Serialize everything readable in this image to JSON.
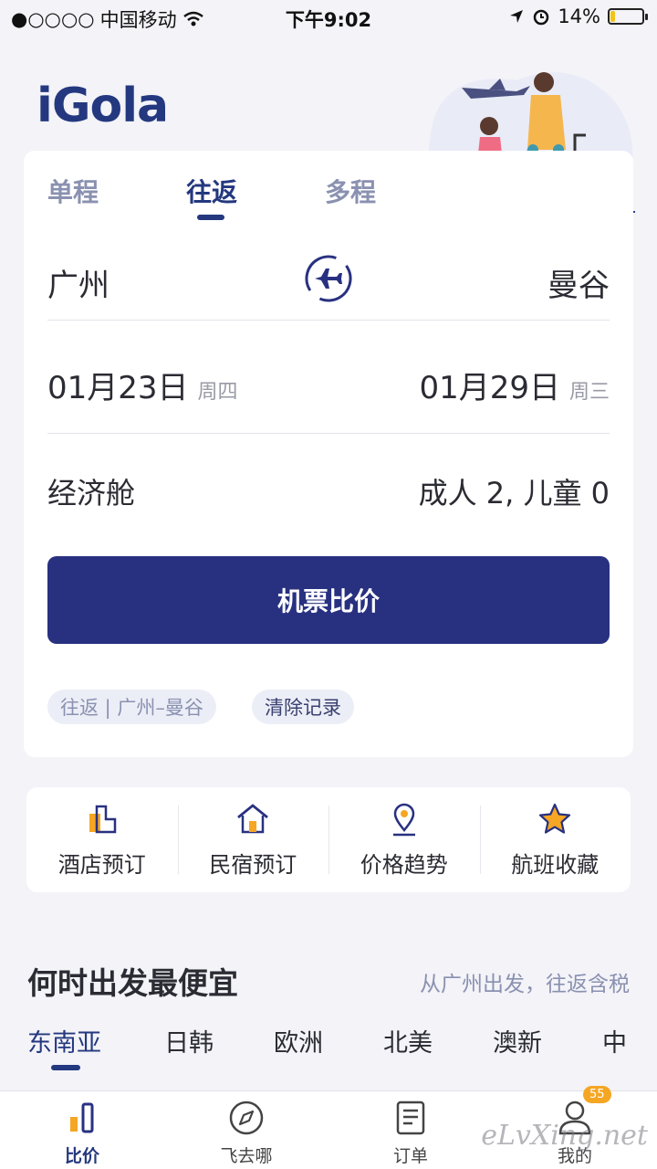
{
  "status_bar": {
    "carrier": "中国移动",
    "time": "下午9:02",
    "battery": "14%",
    "battery_level": 0.14
  },
  "brand": {
    "logo": "iGola"
  },
  "trip_tabs": [
    {
      "label": "单程",
      "active": false
    },
    {
      "label": "往返",
      "active": true
    },
    {
      "label": "多程",
      "active": false
    }
  ],
  "route": {
    "from": "广州",
    "to": "曼谷"
  },
  "dates": {
    "depart": "01月23日",
    "depart_weekday": "周四",
    "return": "01月29日",
    "return_weekday": "周三"
  },
  "cabin": "经济舱",
  "passengers": "成人 2, 儿童 0",
  "search_button": "机票比价",
  "history": {
    "recent": "往返 | 广州–曼谷",
    "clear": "清除记录"
  },
  "quick_links": [
    {
      "label": "酒店预订",
      "icon": "hotel-icon"
    },
    {
      "label": "民宿预订",
      "icon": "homestay-icon"
    },
    {
      "label": "价格趋势",
      "icon": "price-trend-icon"
    },
    {
      "label": "航班收藏",
      "icon": "favorite-star-icon"
    }
  ],
  "cheapest": {
    "title": "何时出发最便宜",
    "subtitle": "从广州出发，往返含税",
    "regions": [
      "东南亚",
      "日韩",
      "欧洲",
      "北美",
      "澳新",
      "中"
    ]
  },
  "bottom_nav": [
    {
      "label": "比价",
      "icon": "compare-bars-icon",
      "active": true
    },
    {
      "label": "飞去哪",
      "icon": "compass-icon",
      "active": false
    },
    {
      "label": "订单",
      "icon": "document-icon",
      "active": false
    },
    {
      "label": "我的",
      "icon": "person-icon",
      "active": false,
      "badge": "55"
    }
  ],
  "watermark": "eLvXing.net",
  "colors": {
    "primary": "#283180",
    "accent": "#f5a623",
    "muted": "#8a91b0"
  }
}
